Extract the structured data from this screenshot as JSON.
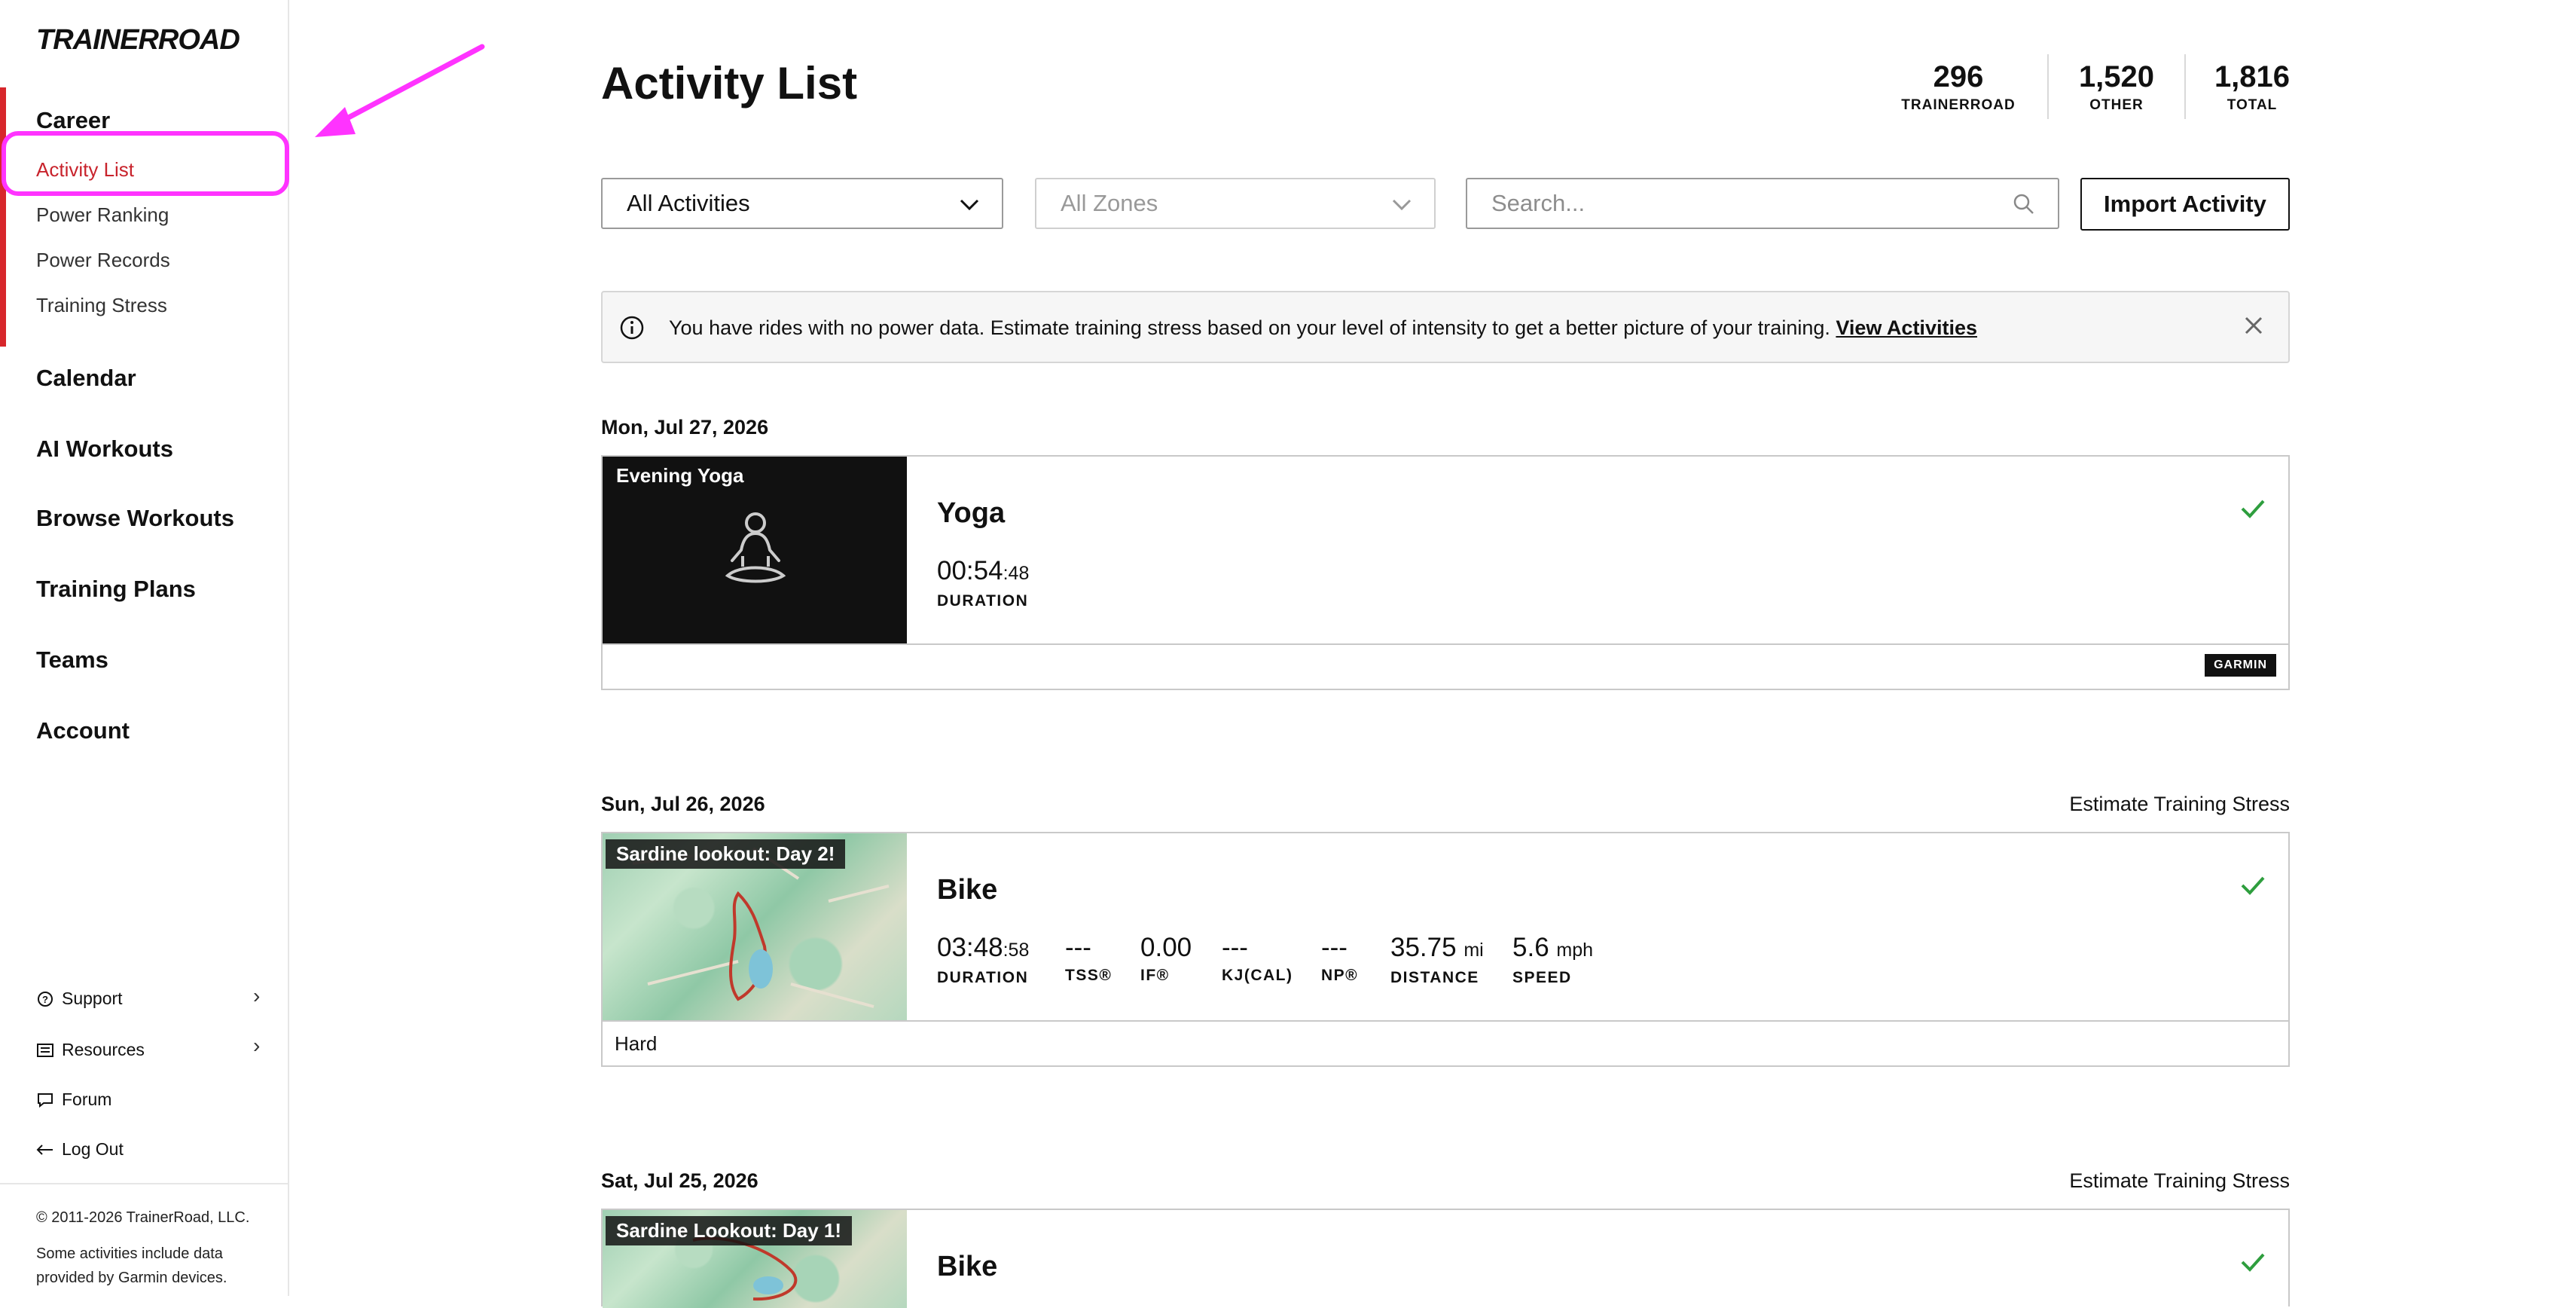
{
  "logo": {
    "text_a": "TRAINER",
    "text_b": "ROAD"
  },
  "sidebar": {
    "career": "Career",
    "career_items": [
      {
        "label": "Activity List"
      },
      {
        "label": "Power Ranking"
      },
      {
        "label": "Power Records"
      },
      {
        "label": "Training Stress"
      }
    ],
    "nav": [
      {
        "label": "Calendar"
      },
      {
        "label": "AI Workouts"
      },
      {
        "label": "Browse Workouts"
      },
      {
        "label": "Training Plans"
      },
      {
        "label": "Teams"
      },
      {
        "label": "Account"
      }
    ],
    "bottom": [
      {
        "label": "Support",
        "icon": "question-circle-icon"
      },
      {
        "label": "Resources",
        "icon": "list-box-icon"
      },
      {
        "label": "Forum",
        "icon": "chat-bubble-icon"
      },
      {
        "label": "Log Out",
        "icon": "arrow-left-icon"
      }
    ],
    "footer_copyright": "© 2011-2026 TrainerRoad, LLC.",
    "footer_note_1": "Some activities include data",
    "footer_note_2": "provided by Garmin devices."
  },
  "header": {
    "title": "Activity List",
    "stats": [
      {
        "value": "296",
        "label": "TRAINERROAD"
      },
      {
        "value": "1,520",
        "label": "OTHER"
      },
      {
        "value": "1,816",
        "label": "TOTAL"
      }
    ]
  },
  "filters": {
    "activities_select": "All Activities",
    "zones_select": "All Zones",
    "search_placeholder": "Search...",
    "import_button": "Import Activity"
  },
  "alert": {
    "message": "You have rides with no power data. Estimate training stress based on your level of intensity to get a better picture of your training.",
    "link": "View Activities"
  },
  "activities": [
    {
      "date": "Mon, Jul 27, 2026",
      "thumb_title": "Evening Yoga",
      "type": "Yoga",
      "duration_main": "00:54",
      "duration_sec": ":48",
      "duration_label": "DURATION",
      "source": "GARMIN"
    },
    {
      "date": "Sun, Jul 26, 2026",
      "estimate": "Estimate Training Stress",
      "thumb_title": "Sardine lookout: Day 2!",
      "type": "Bike",
      "metrics": {
        "duration_main": "03:48",
        "duration_sec": ":58",
        "duration_label": "DURATION",
        "tss": "---",
        "tss_label": "TSS®",
        "if": "0.00",
        "if_label": "IF®",
        "kj": "---",
        "kj_label": "KJ(CAL)",
        "np": "---",
        "np_label": "NP®",
        "distance": "35.75",
        "distance_unit": "mi",
        "distance_label": "DISTANCE",
        "speed": "5.6",
        "speed_unit": "mph",
        "speed_label": "SPEED"
      },
      "rpe": "Hard"
    },
    {
      "date": "Sat, Jul 25, 2026",
      "estimate": "Estimate Training Stress",
      "thumb_title": "Sardine Lookout: Day 1!",
      "type": "Bike"
    }
  ],
  "colors": {
    "accent_red": "#c8232c",
    "annotation": "#ff33ff",
    "check_green": "#2e9e3e"
  }
}
